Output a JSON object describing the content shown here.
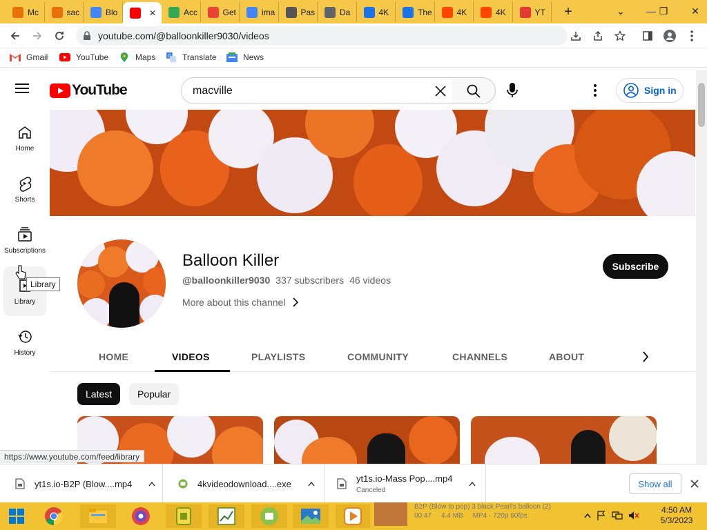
{
  "browser": {
    "tabs": [
      {
        "label": "Mc",
        "color": "#e8710a"
      },
      {
        "label": "sac",
        "color": "#e8710a"
      },
      {
        "label": "Blo",
        "color": "#4285f4"
      },
      {
        "label": "",
        "color": "#ff0000",
        "active": true
      },
      {
        "label": "Acc",
        "color": "#34a853"
      },
      {
        "label": "Get",
        "color": "#ea4335"
      },
      {
        "label": "ima",
        "color": "#4285f4"
      },
      {
        "label": "Pas",
        "color": "#555555"
      },
      {
        "label": "Da",
        "color": "#5f6368"
      },
      {
        "label": "4K",
        "color": "#1a73e8"
      },
      {
        "label": "The",
        "color": "#1a73e8"
      },
      {
        "label": "4K",
        "color": "#ff4500"
      },
      {
        "label": "4K",
        "color": "#ff4500"
      },
      {
        "label": "YT",
        "color": "#e53935"
      }
    ],
    "new_tab": "+",
    "window_controls": {
      "dropdown": "⌄",
      "minimize": "—",
      "restore": "❐",
      "close": "✕"
    },
    "url": "youtube.com/@balloonkiller9030/videos",
    "bookmarks": [
      "Gmail",
      "YouTube",
      "Maps",
      "Translate",
      "News"
    ]
  },
  "youtube": {
    "logo_text": "YouTube",
    "search_value": "macville",
    "sign_in": "Sign in",
    "sidebar": [
      {
        "label": "Home",
        "icon": "home-icon"
      },
      {
        "label": "Shorts",
        "icon": "shorts-icon"
      },
      {
        "label": "Subscriptions",
        "icon": "subscriptions-icon"
      },
      {
        "label": "Library",
        "icon": "library-icon"
      },
      {
        "label": "History",
        "icon": "history-icon"
      }
    ],
    "tooltip": "Library",
    "channel": {
      "name": "Balloon Killer",
      "handle": "@balloonkiller9030",
      "subscribers": "337 subscribers",
      "videos": "46 videos",
      "more": "More about this channel",
      "subscribe": "Subscribe"
    },
    "channel_tabs": [
      "HOME",
      "VIDEOS",
      "PLAYLISTS",
      "COMMUNITY",
      "CHANNELS",
      "ABOUT"
    ],
    "active_tab": "VIDEOS",
    "chips": [
      "Latest",
      "Popular"
    ],
    "status_url": "https://www.youtube.com/feed/library"
  },
  "downloads": {
    "items": [
      {
        "name": "yt1s.io-B2P (Blow....mp4",
        "status": ""
      },
      {
        "name": "4kvideodownload....exe",
        "status": ""
      },
      {
        "name": "yt1s.io-Mass Pop....mp4",
        "status": "Canceled"
      }
    ],
    "show_all": "Show all"
  },
  "taskbar": {
    "media_title": "B2P (Blow to pop) 3 black Pearl's balloon (2)",
    "media_duration": "00:47",
    "media_size": "4.4 MB",
    "media_format": "MP4 · 720p 60fps",
    "time": "4:50 AM",
    "date": "5/3/2023"
  },
  "colors": {
    "tabstrip": "#f6c84a",
    "taskbar": "#f1c232",
    "yt_red": "#ff0000",
    "link_blue": "#065fd4"
  }
}
